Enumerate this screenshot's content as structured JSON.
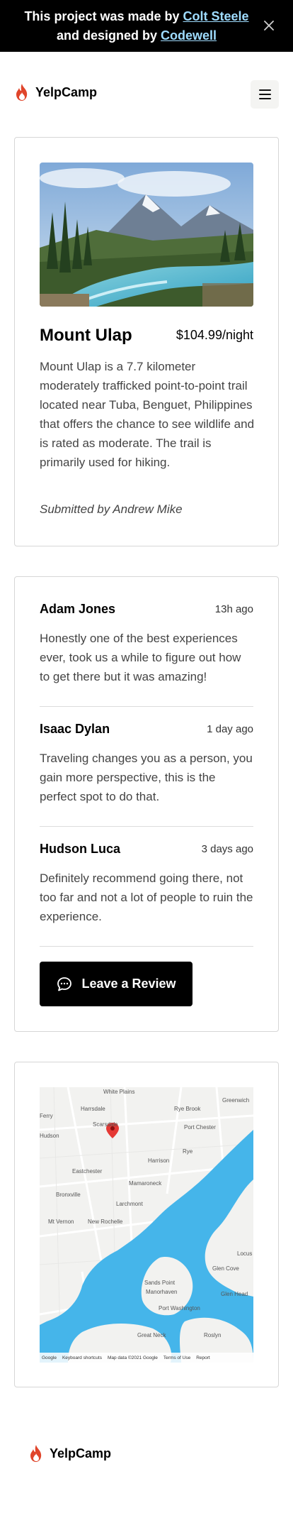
{
  "banner": {
    "text_prefix": "This project was made by ",
    "author_link": "Colt Steele",
    "text_middle": " and designed by ",
    "designer_link": "Codewell"
  },
  "nav": {
    "brand": "YelpCamp"
  },
  "campground": {
    "title": "Mount Ulap",
    "price": "$104.99/night",
    "description": "Mount Ulap is a 7.7 kilometer moderately trafficked point-to-point trail located near Tuba, Benguet, Philippines that offers the chance to see wildlife and is rated as moderate. The trail is primarily used for hiking.",
    "submitted_by": "Submitted by Andrew Mike"
  },
  "reviews": [
    {
      "name": "Adam Jones",
      "time": "13h ago",
      "body": "Honestly one of the best experiences ever, took us a while to figure out how to get there but it was amazing!"
    },
    {
      "name": "Isaac Dylan",
      "time": "1 day ago",
      "body": "Traveling changes you as a person, you gain more perspective, this is the perfect spot to do that."
    },
    {
      "name": "Hudson Luca",
      "time": "3 days ago",
      "body": "Definitely recommend going there, not too far and not a lot of people to ruin the experience."
    }
  ],
  "leave_review_label": "Leave a Review",
  "map": {
    "places": [
      "White Plains",
      "Greenwich",
      "Rye Brook",
      "Harrsdale",
      "Port Chester",
      "Scarsdale",
      "Rye",
      "Harrison",
      "Eastchester",
      "Mamaroneck",
      "Bronxville",
      "Larchmont",
      "Mt Vernon",
      "New Rochelle",
      "Glen Cove",
      "Glen Head",
      "Sands Point",
      "Manorhaven",
      "Port Washington",
      "Great Neck",
      "Roslyn",
      "Locus",
      "Hudson",
      "Ferry"
    ],
    "footer": {
      "brand": "Google",
      "shortcuts": "Keyboard shortcuts",
      "map_data": "Map data ©2021 Google",
      "terms": "Terms of Use",
      "report": "Report"
    },
    "water_color": "#45b5ea",
    "pin_color": "#e53935"
  },
  "footer": {
    "brand": "YelpCamp"
  },
  "colors": {
    "banner_bg": "#000000",
    "link": "#9fdcff",
    "flame": "#e0452b",
    "button_bg": "#000000"
  }
}
